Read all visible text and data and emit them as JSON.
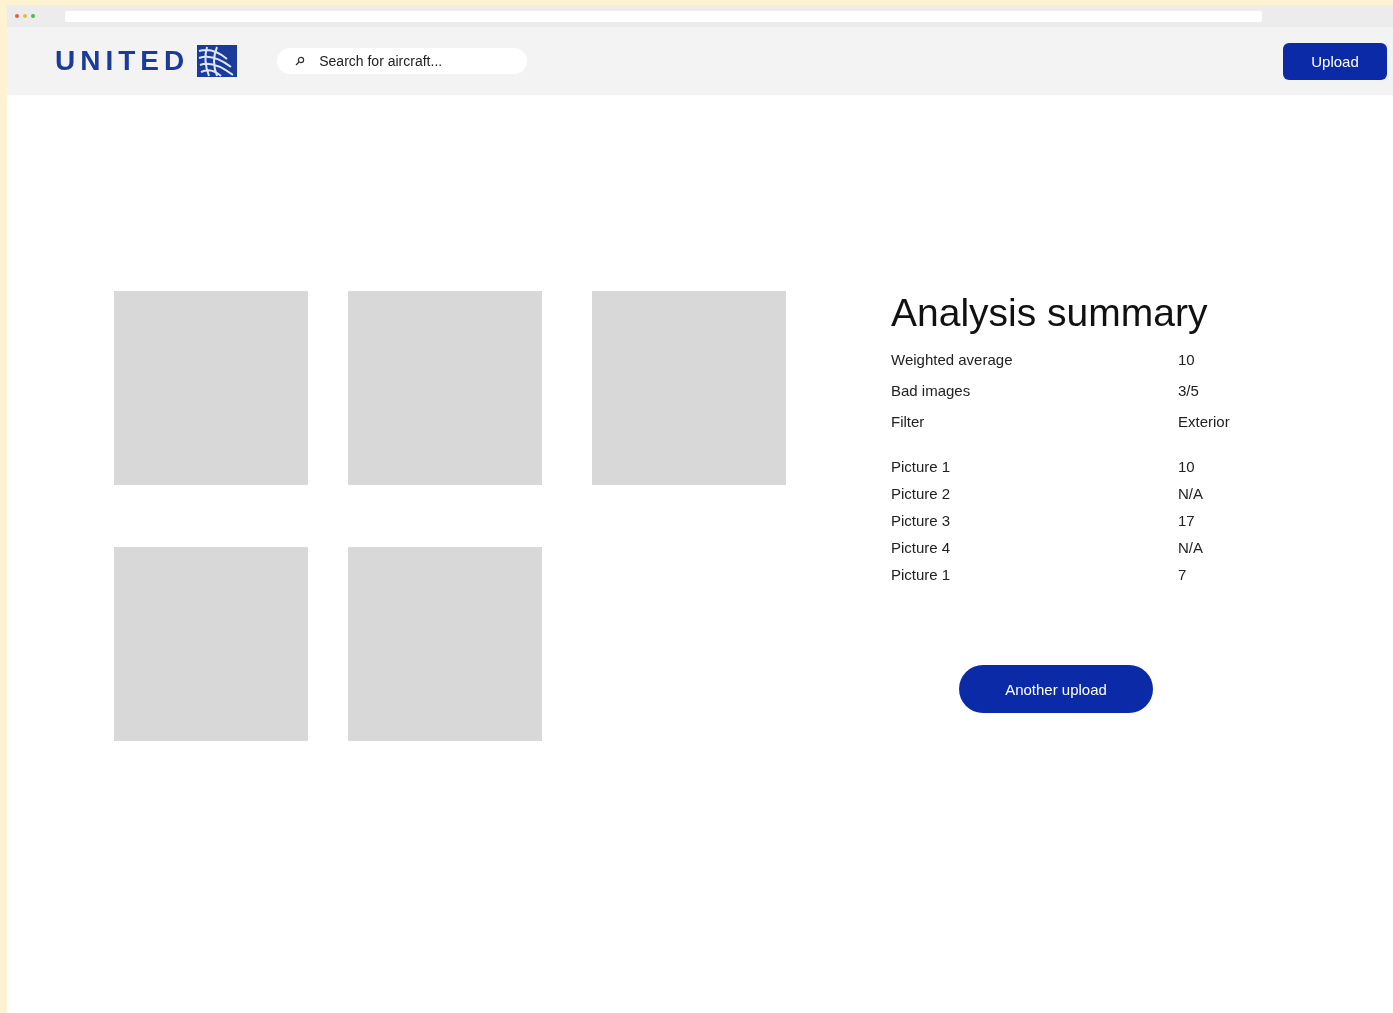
{
  "header": {
    "brand": "UNITED",
    "search": {
      "placeholder": "Search for aircraft..."
    },
    "upload_button": "Upload"
  },
  "gallery": [
    {
      "kind": "placeholder"
    },
    {
      "kind": "placeholder"
    },
    {
      "kind": "placeholder"
    },
    {
      "kind": "placeholder"
    },
    {
      "kind": "placeholder"
    }
  ],
  "summary": {
    "title": "Analysis summary",
    "stats": [
      {
        "label": "Weighted average",
        "value": "10"
      },
      {
        "label": "Bad images",
        "value": "3/5"
      },
      {
        "label": "Filter",
        "value": "Exterior"
      }
    ],
    "pictures": [
      {
        "label": "Picture 1",
        "value": "10"
      },
      {
        "label": "Picture 2",
        "value": "N/A"
      },
      {
        "label": "Picture 3",
        "value": "17"
      },
      {
        "label": "Picture 4",
        "value": "N/A"
      },
      {
        "label": "Picture 1",
        "value": "7"
      }
    ],
    "button": "Another upload"
  }
}
